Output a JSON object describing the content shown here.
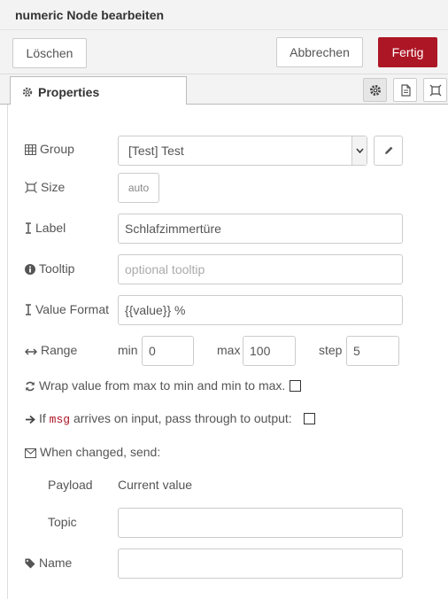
{
  "header": {
    "title": "numeric Node bearbeiten"
  },
  "buttons": {
    "delete": "Löschen",
    "cancel": "Abbrechen",
    "done": "Fertig"
  },
  "tabs": {
    "properties": "Properties"
  },
  "form": {
    "group": {
      "label": "Group",
      "value": "[Test] Test"
    },
    "size": {
      "label": "Size",
      "value": "auto"
    },
    "label": {
      "label": "Label",
      "value": "Schlafzimmertüre"
    },
    "tooltip": {
      "label": "Tooltip",
      "placeholder": "optional tooltip"
    },
    "format": {
      "label": "Value Format",
      "value": "{{value}} %"
    },
    "range": {
      "label": "Range",
      "min_label": "min",
      "min_value": "0",
      "max_label": "max",
      "max_value": "100",
      "step_label": "step",
      "step_value": "5"
    },
    "wrap": {
      "label": "Wrap value from max to min and min to max."
    },
    "passthru": {
      "before": "If ",
      "code": "msg",
      "after": " arrives on input, pass through to output:"
    },
    "send": {
      "label": "When changed, send:"
    },
    "payload": {
      "label": "Payload",
      "value": "Current value"
    },
    "topic": {
      "label": "Topic",
      "value": ""
    },
    "name": {
      "label": "Name",
      "value": ""
    }
  },
  "colors": {
    "accent": "#ad1625",
    "toolbar_bg": "#f3f3f3",
    "border": "#cccccc"
  }
}
